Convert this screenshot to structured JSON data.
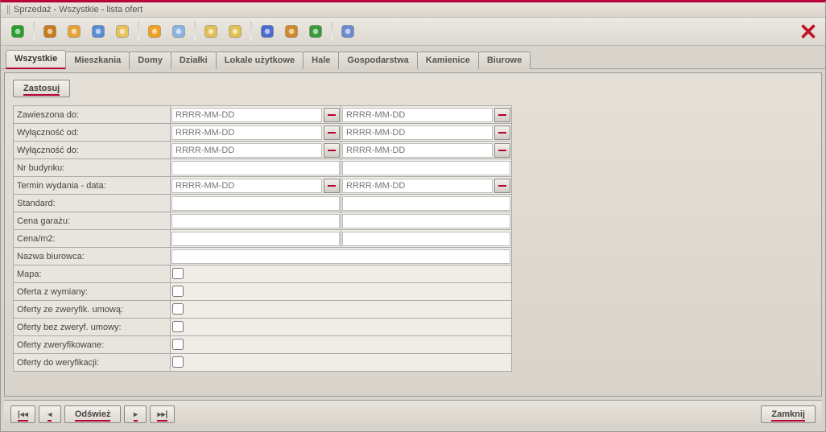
{
  "window": {
    "title": "Sprzedaż - Wszystkie - lista ofert"
  },
  "toolbar_icons": [
    {
      "name": "refresh-icon",
      "fill": "#2e9e2e"
    },
    {
      "name": "briefcase-icon",
      "fill": "#c77b1a"
    },
    {
      "name": "user-icon",
      "fill": "#e8a23a"
    },
    {
      "name": "picture-icon",
      "fill": "#5a8bd6"
    },
    {
      "name": "hand-icon",
      "fill": "#e8c25a"
    },
    {
      "name": "star-icon",
      "fill": "#f0a020"
    },
    {
      "name": "copy-icon",
      "fill": "#8bb3e0"
    },
    {
      "name": "mail-out-icon",
      "fill": "#e0c050"
    },
    {
      "name": "mail-in-icon",
      "fill": "#e0c050"
    },
    {
      "name": "font-icon",
      "fill": "#4a6cd0"
    },
    {
      "name": "gear-icon",
      "fill": "#d08a2a"
    },
    {
      "name": "globe-icon",
      "fill": "#3a9a3a"
    },
    {
      "name": "search-user-icon",
      "fill": "#6a8ad0"
    }
  ],
  "tabs": [
    {
      "label": "Wszystkie",
      "active": true
    },
    {
      "label": "Mieszkania",
      "active": false
    },
    {
      "label": "Domy",
      "active": false
    },
    {
      "label": "Działki",
      "active": false
    },
    {
      "label": "Lokale użytkowe",
      "active": false
    },
    {
      "label": "Hale",
      "active": false
    },
    {
      "label": "Gospodarstwa",
      "active": false
    },
    {
      "label": "Kamienice",
      "active": false
    },
    {
      "label": "Biurowe",
      "active": false
    }
  ],
  "buttons": {
    "apply": "Zastosuj",
    "refresh": "Odśwież",
    "close": "Zamknij",
    "nav_first": "❘◀◀",
    "nav_prev": "◀",
    "nav_next": "▶",
    "nav_last": "▶▶❘"
  },
  "date_placeholder": "RRRR-MM-DD",
  "form_rows": [
    {
      "label": "Zawieszona do:",
      "type": "date2"
    },
    {
      "label": "Wyłączność od:",
      "type": "date2"
    },
    {
      "label": "Wyłączność do:",
      "type": "date2"
    },
    {
      "label": "Nr budynku:",
      "type": "text2"
    },
    {
      "label": "Termin wydania - data:",
      "type": "date2"
    },
    {
      "label": "Standard:",
      "type": "text2"
    },
    {
      "label": "Cena garażu:",
      "type": "text2"
    },
    {
      "label": "Cena/m2:",
      "type": "text2"
    },
    {
      "label": "Nazwa biurowca:",
      "type": "textwide"
    },
    {
      "label": "Mapa:",
      "type": "check"
    },
    {
      "label": "Oferta z wymiany:",
      "type": "check"
    },
    {
      "label": "Oferty ze zweryfik. umową:",
      "type": "check"
    },
    {
      "label": "Oferty bez zweryf. umowy:",
      "type": "check"
    },
    {
      "label": "Oferty zweryfikowane:",
      "type": "check"
    },
    {
      "label": "Oferty do weryfikacji:",
      "type": "check"
    }
  ]
}
